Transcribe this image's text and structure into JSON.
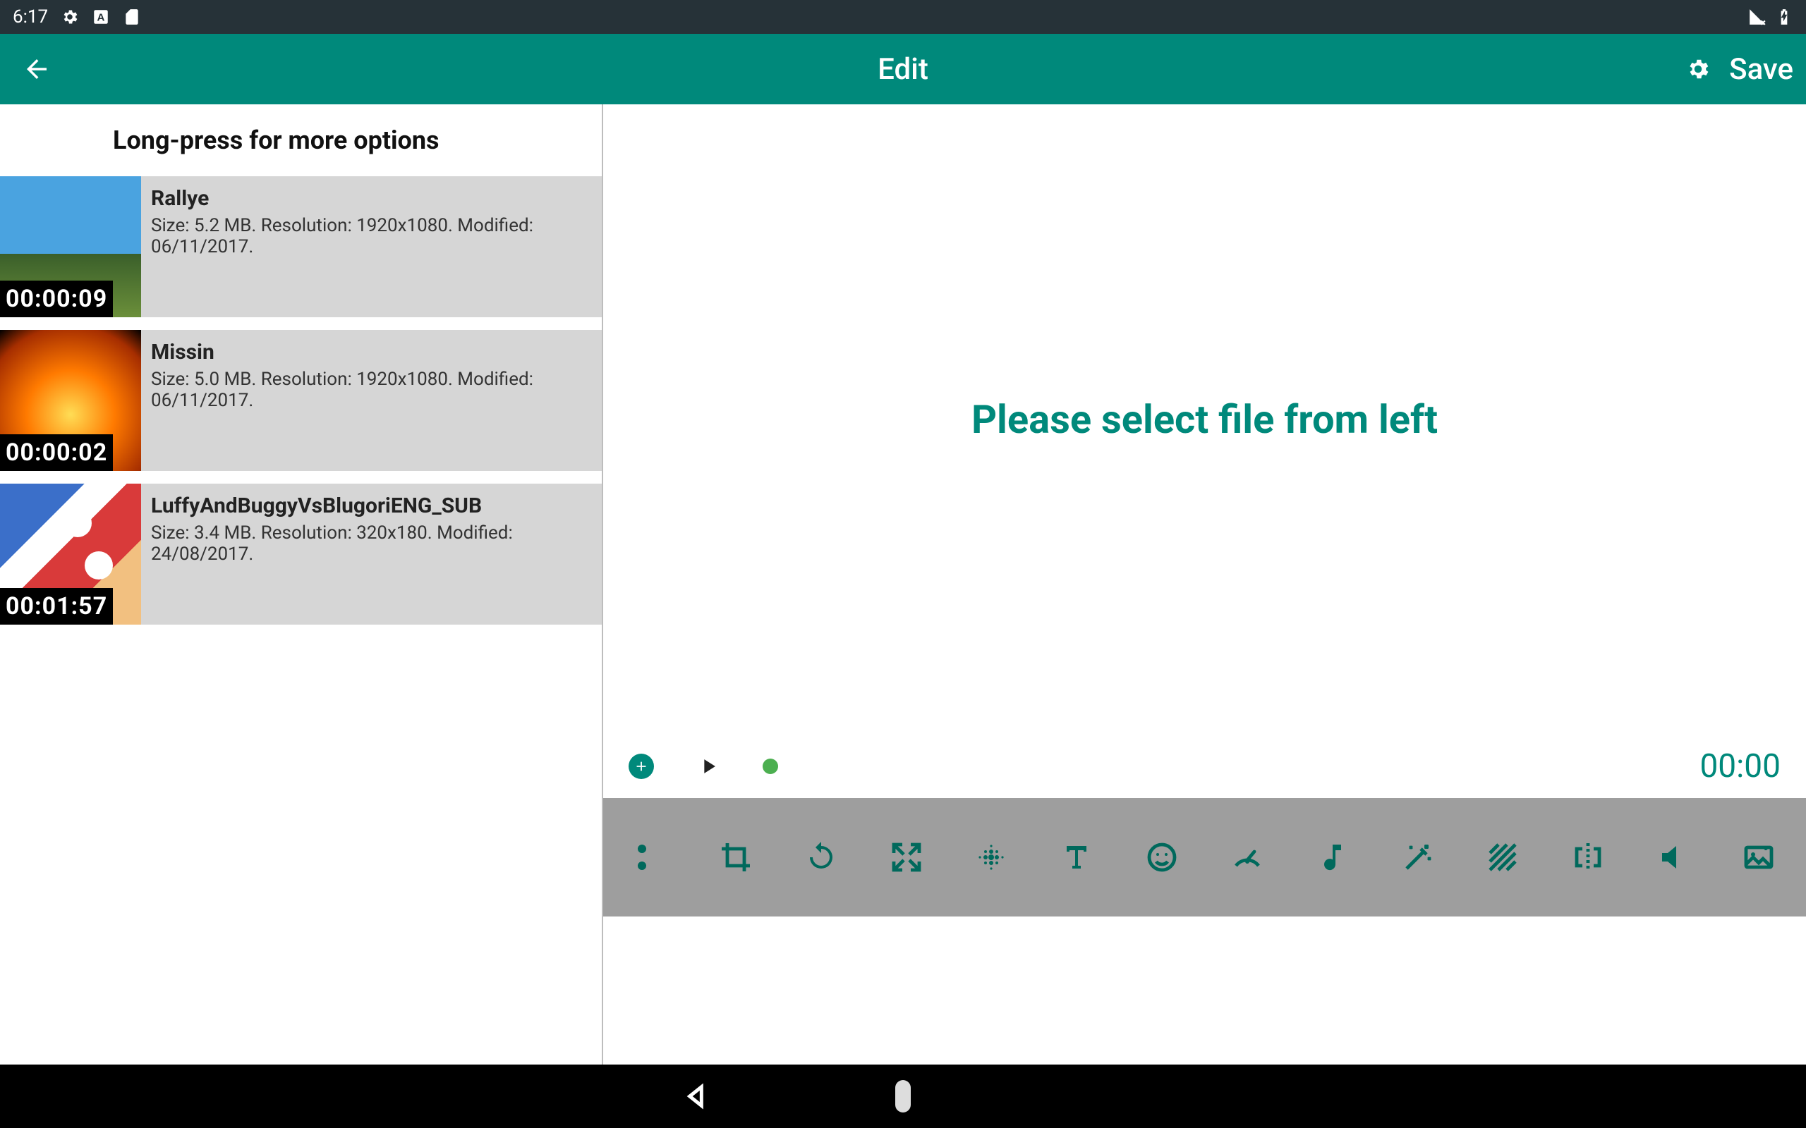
{
  "status": {
    "time": "6:17"
  },
  "appbar": {
    "title": "Edit",
    "save_label": "Save"
  },
  "sidebar": {
    "hint": "Long-press for more options",
    "items": [
      {
        "name": "Rallye",
        "duration": "00:00:09",
        "detail": "Size: 5.2 MB. Resolution: 1920x1080. Modified: 06/11/2017."
      },
      {
        "name": "Missin",
        "duration": "00:00:02",
        "detail": "Size: 5.0 MB. Resolution: 1920x1080. Modified: 06/11/2017."
      },
      {
        "name": "LuffyAndBuggyVsBlugoriENG_SUB",
        "duration": "00:01:57",
        "detail": "Size: 3.4 MB. Resolution: 320x180. Modified: 24/08/2017."
      }
    ]
  },
  "preview": {
    "empty_message": "Please select file from left"
  },
  "player": {
    "time": "00:00"
  },
  "colors": {
    "accent": "#00897B",
    "accent_dark": "#00695C",
    "toolbar_bg": "#9E9E9E"
  }
}
